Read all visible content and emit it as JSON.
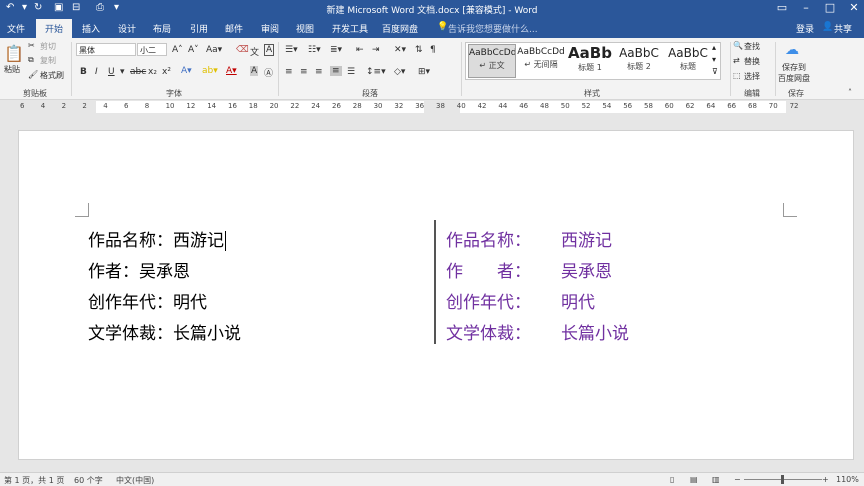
{
  "app": {
    "title": "新建 Microsoft Word 文档.docx [兼容模式] - Word",
    "login": "登录",
    "share": "共享"
  },
  "tabs": [
    "文件",
    "开始",
    "插入",
    "设计",
    "布局",
    "引用",
    "邮件",
    "审阅",
    "视图",
    "开发工具",
    "百度网盘"
  ],
  "tell_me": "告诉我您想要做什么...",
  "ribbon": {
    "clipboard": {
      "paste": "粘贴",
      "cut": "剪切",
      "copy": "复制",
      "format_painter": "格式刷",
      "label": "剪贴板"
    },
    "font": {
      "name": "黑体",
      "size": "小二",
      "label": "字体"
    },
    "paragraph": {
      "label": "段落"
    },
    "styles": {
      "items": [
        {
          "sample": "AaBbCcDd",
          "name": "↵ 正文"
        },
        {
          "sample": "AaBbCcDd",
          "name": "↵ 无间隔"
        },
        {
          "sample": "AaBb",
          "name": "标题 1"
        },
        {
          "sample": "AaBbC",
          "name": "标题 2"
        },
        {
          "sample": "AaBbC",
          "name": "标题"
        }
      ],
      "label": "样式"
    },
    "editing": {
      "find": "查找",
      "replace": "替换",
      "select": "选择",
      "label": "编辑"
    },
    "save": {
      "line1": "保存到",
      "line2": "百度网盘",
      "label": "保存"
    }
  },
  "ruler_numbers": [
    "6",
    "4",
    "2",
    "2",
    "4",
    "6",
    "8",
    "10",
    "12",
    "14",
    "16",
    "18",
    "20",
    "22",
    "24",
    "26",
    "28",
    "30",
    "32",
    "36",
    "38",
    "40",
    "42",
    "44",
    "46",
    "48",
    "50",
    "52",
    "54",
    "56",
    "58",
    "60",
    "62",
    "64",
    "66",
    "68",
    "70",
    "72"
  ],
  "document": {
    "left": [
      "作品名称：西游记",
      "作者：吴承恩",
      "创作年代：明代",
      "文学体裁：长篇小说"
    ],
    "right": [
      {
        "label": "作品名称：",
        "value": "西游记"
      },
      {
        "label": "作　　者：",
        "value": "吴承恩"
      },
      {
        "label": "创作年代：",
        "value": "明代"
      },
      {
        "label": "文学体裁：",
        "value": "长篇小说"
      }
    ],
    "colors": {
      "right_text": "#7030a0",
      "left_text": "#000000"
    }
  },
  "status": {
    "page": "第 1 页，共 1 页",
    "words": "60 个字",
    "language": "中文(中国)",
    "zoom": "110%"
  }
}
